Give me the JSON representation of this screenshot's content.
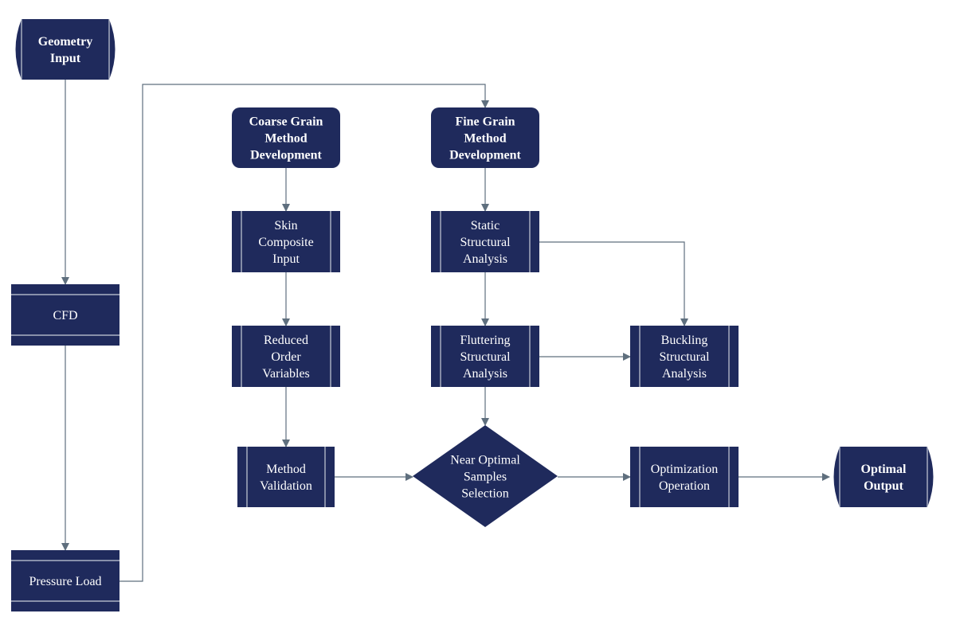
{
  "colors": {
    "node_fill": "#1f2a5c",
    "node_inner_line": "#c8cdd8",
    "connector": "#5f6f7e",
    "text": "#ffffff"
  },
  "nodes": {
    "geometry_input": {
      "shape": "terminator",
      "bold": true,
      "lines": [
        "Geometry",
        "Input"
      ]
    },
    "cfd": {
      "shape": "horizontal-banded-process",
      "bold": false,
      "lines": [
        "CFD"
      ]
    },
    "pressure_load": {
      "shape": "horizontal-banded-process",
      "bold": false,
      "lines": [
        "Pressure Load"
      ]
    },
    "coarse_grain": {
      "shape": "rounded-rectangle",
      "bold": true,
      "lines": [
        "Coarse Grain",
        "Method",
        "Development"
      ]
    },
    "skin_composite": {
      "shape": "predefined-process",
      "bold": false,
      "lines": [
        "Skin",
        "Composite",
        "Input"
      ]
    },
    "reduced_order": {
      "shape": "predefined-process",
      "bold": false,
      "lines": [
        "Reduced",
        "Order",
        "Variables"
      ]
    },
    "method_validation": {
      "shape": "predefined-process",
      "bold": false,
      "lines": [
        "Method",
        "Validation"
      ]
    },
    "fine_grain": {
      "shape": "rounded-rectangle",
      "bold": true,
      "lines": [
        "Fine Grain",
        "Method",
        "Development"
      ]
    },
    "static_structural": {
      "shape": "predefined-process",
      "bold": false,
      "lines": [
        "Static",
        "Structural",
        "Analysis"
      ]
    },
    "fluttering_structural": {
      "shape": "predefined-process",
      "bold": false,
      "lines": [
        "Fluttering",
        "Structural",
        "Analysis"
      ]
    },
    "buckling_structural": {
      "shape": "predefined-process",
      "bold": false,
      "lines": [
        "Buckling",
        "Structural",
        "Analysis"
      ]
    },
    "near_optimal": {
      "shape": "decision",
      "bold": false,
      "lines": [
        "Near Optimal",
        "Samples",
        "Selection"
      ]
    },
    "optimization_operation": {
      "shape": "predefined-process",
      "bold": false,
      "lines": [
        "Optimization",
        "Operation"
      ]
    },
    "optimal_output": {
      "shape": "terminator",
      "bold": true,
      "lines": [
        "Optimal",
        "Output"
      ]
    }
  },
  "edges": [
    [
      "geometry_input",
      "cfd"
    ],
    [
      "cfd",
      "pressure_load"
    ],
    [
      "pressure_load",
      "fine_grain"
    ],
    [
      "coarse_grain",
      "skin_composite"
    ],
    [
      "skin_composite",
      "reduced_order"
    ],
    [
      "reduced_order",
      "method_validation"
    ],
    [
      "method_validation",
      "near_optimal"
    ],
    [
      "fine_grain",
      "static_structural"
    ],
    [
      "static_structural",
      "fluttering_structural"
    ],
    [
      "fluttering_structural",
      "near_optimal"
    ],
    [
      "static_structural",
      "buckling_structural"
    ],
    [
      "fluttering_structural",
      "buckling_structural"
    ],
    [
      "near_optimal",
      "optimization_operation"
    ],
    [
      "optimization_operation",
      "optimal_output"
    ]
  ]
}
